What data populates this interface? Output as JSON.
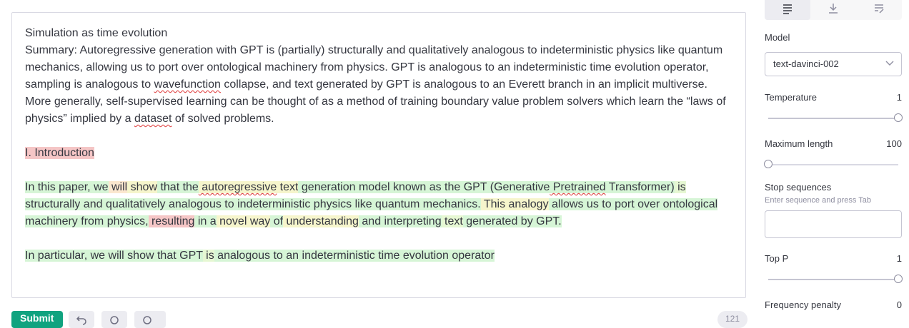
{
  "document": {
    "title": "Simulation as time evolution",
    "summary_parts": [
      "Summary: Autoregressive generation with GPT is (partially) structurally and qualitatively analogous to indeterministic physics like quantum mechanics, allowing us to port over ontological machinery from physics. GPT is analogous to an indeterministic time evolution operator, sampling is analogous to ",
      "wavefunction",
      " collapse, and text generated by GPT is analogous to an Everett branch in an implicit multiverse. More generally, self-supervised learning can be thought of as a method of training boundary value problem solvers which learn the “laws of physics” implied by a ",
      "dataset",
      " of solved problems."
    ],
    "heading": "I. Introduction",
    "para1_tokens": [
      "In",
      " this",
      " paper,",
      " we",
      " will",
      " show",
      " that",
      " the",
      " autoregressive",
      " text",
      " generation",
      " model",
      " known",
      " as",
      " the",
      " GPT",
      " (Generative",
      " Pretrained",
      " Transformer)",
      " is",
      " structurally",
      " and",
      " qualitatively",
      " analogous",
      " to",
      " indeterministic",
      " physics",
      " like",
      " quantum",
      " mechanics.",
      " This",
      " analogy",
      " allows",
      " us",
      " to",
      " port",
      " over",
      " ontological",
      " machinery",
      " from",
      " physics,",
      " resulting",
      " in",
      " a",
      " novel",
      " way",
      " of",
      " understanding",
      " and",
      " interpreting",
      " text",
      " generated",
      " by",
      " GPT."
    ],
    "para2_tokens": [
      "In",
      " particular,",
      " we",
      " will",
      " show",
      " that",
      " GPT",
      " is",
      " analogous",
      " to",
      " an",
      " indeterministic",
      " time",
      " evolution",
      " operator"
    ]
  },
  "toolbar": {
    "submit_label": "Submit",
    "token_count": "121"
  },
  "settings": {
    "model_label": "Model",
    "model_value": "text-davinci-002",
    "temperature_label": "Temperature",
    "temperature_value": "1",
    "temperature_level": 1.0,
    "max_length_label": "Maximum length",
    "max_length_value": "100",
    "max_length_level": 0.0,
    "stop_label": "Stop sequences",
    "stop_hint": "Enter sequence and press Tab",
    "top_p_label": "Top P",
    "top_p_value": "1",
    "top_p_level": 1.0,
    "freq_label": "Frequency penalty",
    "freq_value": "0"
  },
  "highlight_colors": {
    "high": "#d6f5d6",
    "mid_high": "#e6f7d3",
    "mid": "#f6f5cc",
    "low": "#fbe7cf",
    "very_low": "#f5c6c6"
  },
  "icons": {
    "mode_complete": "align-lines-icon",
    "mode_insert": "insert-down-icon",
    "mode_edit": "edit-lines-icon",
    "select_caret": "chevron-down-icon"
  }
}
